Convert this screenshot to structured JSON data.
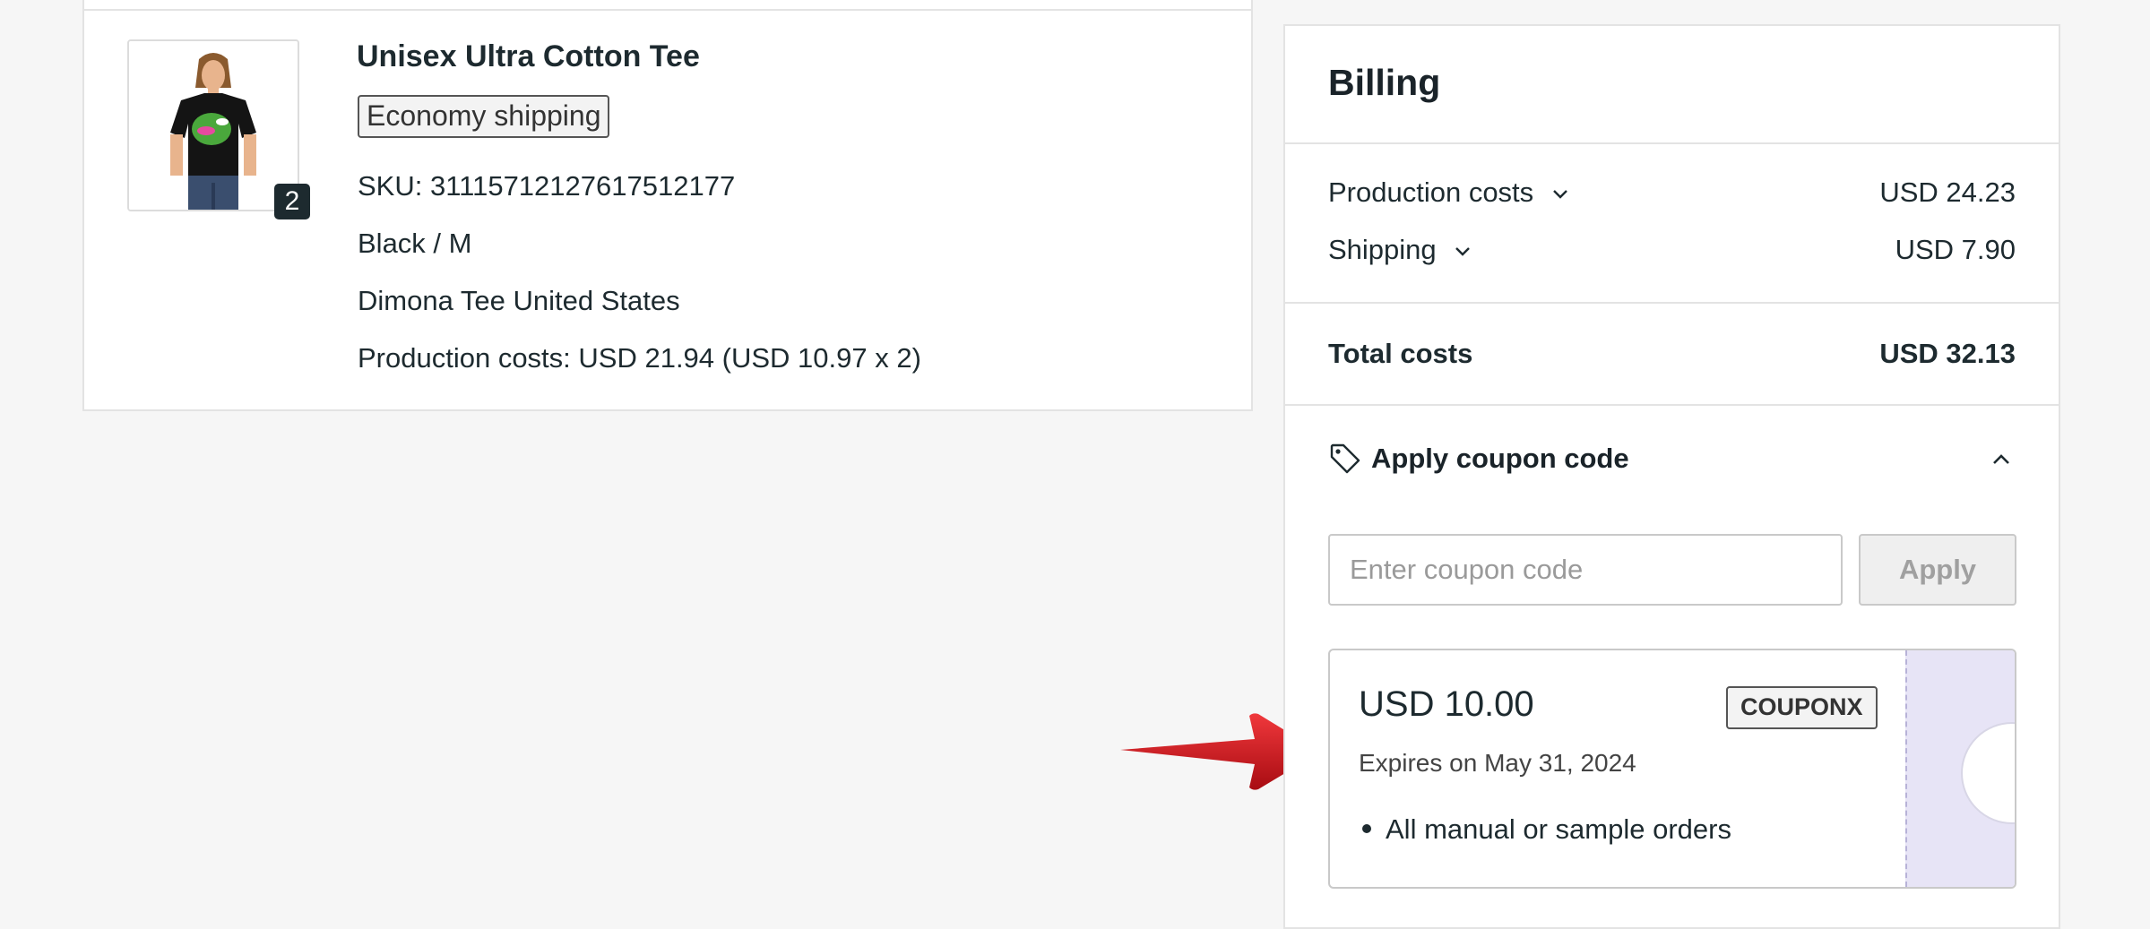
{
  "order_item": {
    "title": "Unisex Ultra Cotton Tee",
    "shipping_chip": "Economy shipping",
    "quantity": "2",
    "sku": "SKU: 31115712127617512177",
    "variant": "Black / M",
    "provider": "Dimona Tee United States",
    "production_costs": "Production costs: USD 21.94 (USD 10.97 x 2)",
    "image_icon": "tshirt-model-image"
  },
  "billing": {
    "title": "Billing",
    "rows": [
      {
        "label": "Production costs",
        "value": "USD 24.23"
      },
      {
        "label": "Shipping",
        "value": "USD 7.90"
      }
    ],
    "total_label": "Total costs",
    "total_value": "USD 32.13",
    "coupon_section": {
      "title": "Apply coupon code",
      "icon": "tag-icon",
      "input_placeholder": "Enter coupon code",
      "input_value": "",
      "apply_label": "Apply"
    },
    "coupon": {
      "amount": "USD 10.00",
      "code": "COUPONX",
      "expiry": "Expires on May 31, 2024",
      "scope": "All manual or sample orders",
      "stub_color": "#e7e4f6"
    }
  },
  "annotation": {
    "arrow_color": "#d4141c"
  }
}
